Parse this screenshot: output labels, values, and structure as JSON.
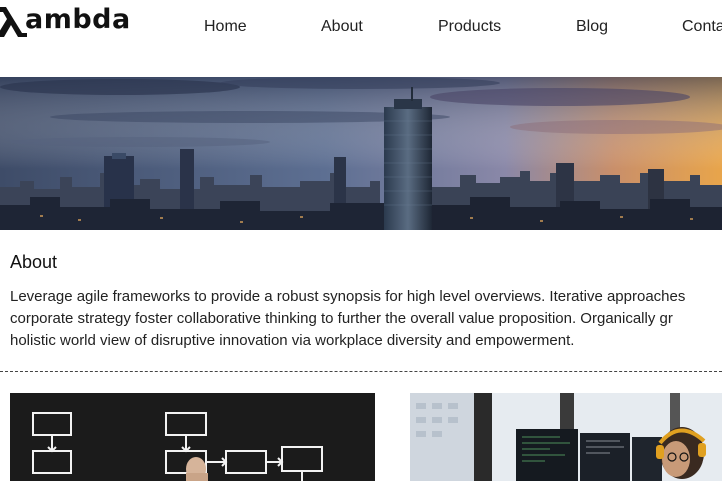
{
  "brand": {
    "logo_text": "ambda"
  },
  "nav": {
    "items": [
      {
        "label": "Home"
      },
      {
        "label": "About"
      },
      {
        "label": "Products"
      },
      {
        "label": "Blog"
      },
      {
        "label": "Conta"
      }
    ]
  },
  "about": {
    "title": "About",
    "lines": [
      "Leverage agile frameworks to provide a robust synopsis for high level overviews. Iterative approaches",
      "corporate strategy foster collaborative thinking to further the overall value proposition. Organically gr",
      "holistic world view of disruptive innovation via workplace diversity and empowerment."
    ]
  },
  "colors": {
    "text": "#1a1a1a",
    "sky_top": "#4a5a78",
    "sky_glow": "#e8a54b",
    "city": "#1f2a3a"
  },
  "images": [
    {
      "name": "hero-city-skyline"
    },
    {
      "name": "flowchart-sketch"
    },
    {
      "name": "person-with-headphones-at-computer"
    }
  ]
}
